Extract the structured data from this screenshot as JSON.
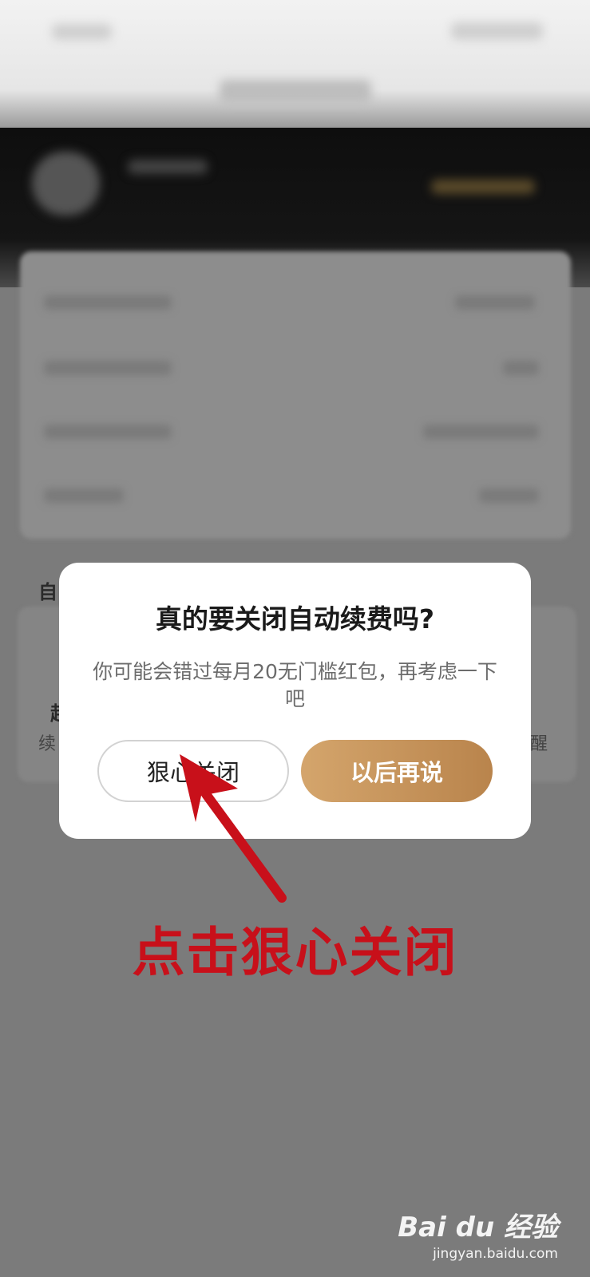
{
  "dialog": {
    "title": "真的要关闭自动续费吗?",
    "message": "你可能会错过每月20无门槛红包，再考虑一下吧",
    "close_button": "狠心关闭",
    "later_button": "以后再说"
  },
  "annotation": {
    "text": "点击狠心关闭",
    "color": "#c8101a"
  },
  "background": {
    "section_fragment": "自",
    "row_fragment_1": "起",
    "row_fragment_2": "续",
    "row_fragment_3": "醒"
  },
  "watermark": {
    "logo": "Bai du 经验",
    "url": "jingyan.baidu.com"
  }
}
